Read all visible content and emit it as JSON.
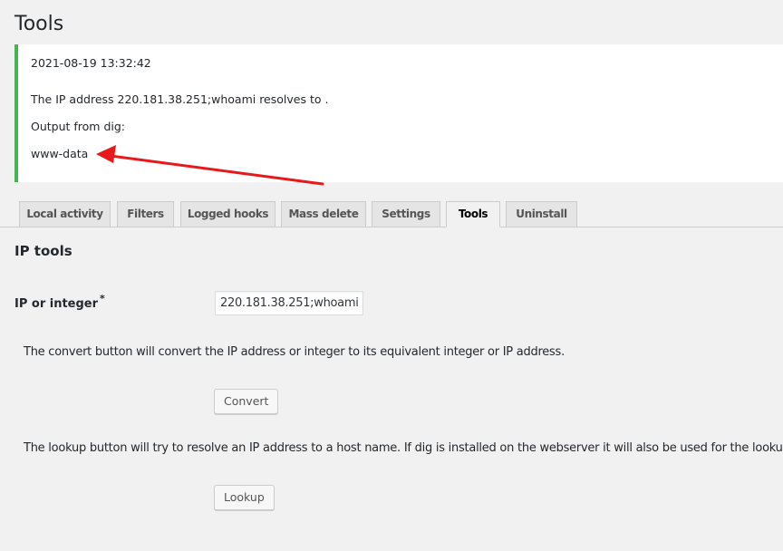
{
  "page_title": "Tools",
  "notice": {
    "timestamp": "2021-08-19 13:32:42",
    "resolve_line": "The IP address 220.181.38.251;whoami resolves to .",
    "dig_heading": "Output from dig:",
    "dig_output": "www-data",
    "accent_color": "#46b450",
    "annotation_arrow_color": "#e8191a"
  },
  "tabs": [
    {
      "label": "Local activity",
      "active": false
    },
    {
      "label": "Filters",
      "active": false
    },
    {
      "label": "Logged hooks",
      "active": false
    },
    {
      "label": "Mass delete",
      "active": false
    },
    {
      "label": "Settings",
      "active": false
    },
    {
      "label": "Tools",
      "active": true
    },
    {
      "label": "Uninstall",
      "active": false
    }
  ],
  "ip_tools": {
    "section_title": "IP tools",
    "field_label": "IP or integer",
    "required_marker": "*",
    "input_value": "220.181.38.251;whoami",
    "convert_description": "The convert button will convert the IP address or integer to its equivalent integer or IP address.",
    "convert_button": "Convert",
    "lookup_description": "The lookup button will try to resolve an IP address to a host name. If dig is installed on the webserver it will also be used for the lookup.",
    "lookup_button": "Lookup"
  }
}
